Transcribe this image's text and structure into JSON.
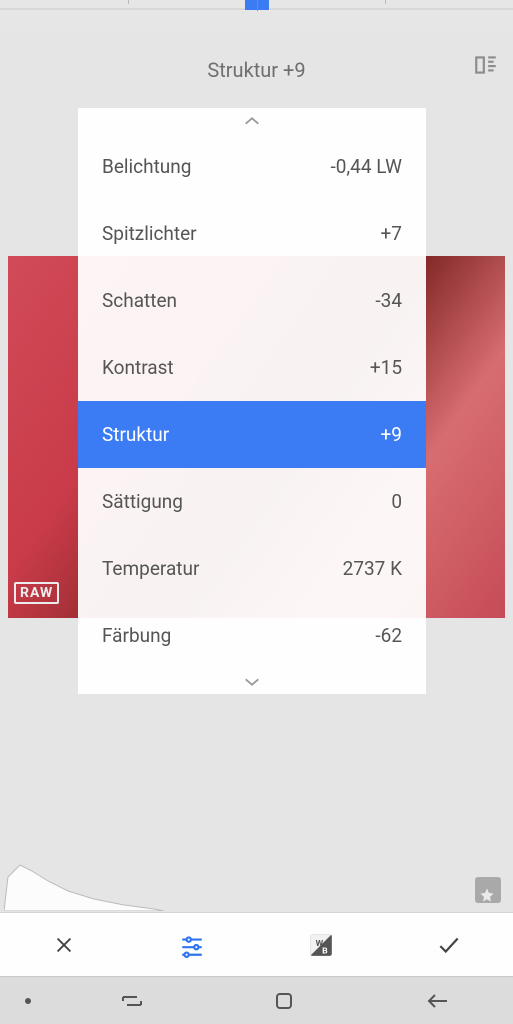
{
  "header": {
    "title": "Struktur +9"
  },
  "raw_badge": "RAW",
  "adjustments": [
    {
      "label": "Belichtung",
      "value": "-0,44 LW",
      "selected": false
    },
    {
      "label": "Spitzlichter",
      "value": "+7",
      "selected": false
    },
    {
      "label": "Schatten",
      "value": "-34",
      "selected": false
    },
    {
      "label": "Kontrast",
      "value": "+15",
      "selected": false
    },
    {
      "label": "Struktur",
      "value": "+9",
      "selected": true
    },
    {
      "label": "Sättigung",
      "value": "0",
      "selected": false
    },
    {
      "label": "Temperatur",
      "value": "2737 K",
      "selected": false
    },
    {
      "label": "Färbung",
      "value": "-62",
      "selected": false
    }
  ],
  "icons": {
    "compare": "compare-icon",
    "chevron_up": "chevron-up-icon",
    "chevron_down": "chevron-down-icon",
    "cancel": "close-icon",
    "tune": "tune-icon",
    "wb": "white-balance-icon",
    "confirm": "check-icon",
    "star": "star-icon",
    "nav_recent": "recents-icon",
    "nav_home": "home-icon",
    "nav_back": "back-icon"
  }
}
